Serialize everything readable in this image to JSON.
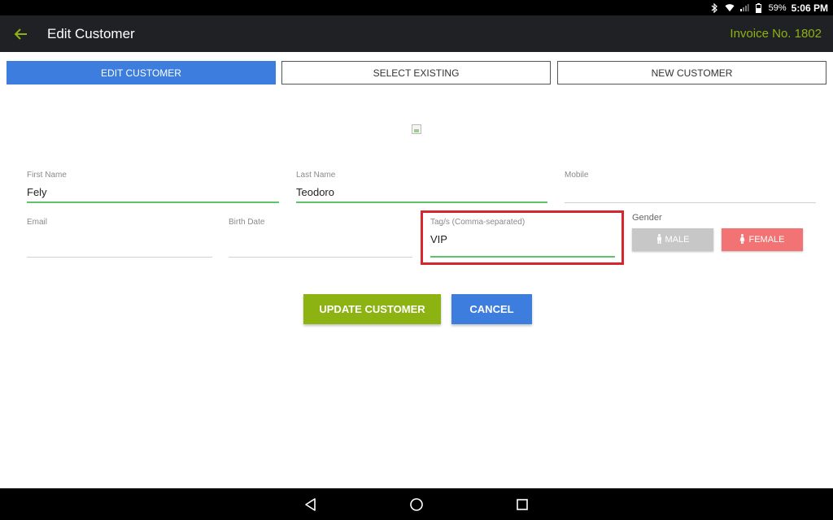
{
  "status_bar": {
    "battery": "59%",
    "time": "5:06 PM",
    "icons": [
      "bluetooth-icon",
      "wifi-icon",
      "signal-icon",
      "battery-icon"
    ]
  },
  "app_bar": {
    "title": "Edit Customer",
    "invoice": "Invoice No. 1802",
    "back_icon": "arrow-left-icon"
  },
  "tabs": [
    {
      "label": "EDIT CUSTOMER",
      "active": true
    },
    {
      "label": "SELECT EXISTING",
      "active": false
    },
    {
      "label": "NEW CUSTOMER",
      "active": false
    }
  ],
  "form": {
    "first_name": {
      "label": "First Name",
      "value": "Fely"
    },
    "last_name": {
      "label": "Last Name",
      "value": "Teodoro"
    },
    "mobile": {
      "label": "Mobile",
      "value": ""
    },
    "email": {
      "label": "Email",
      "value": ""
    },
    "birth_date": {
      "label": "Birth Date",
      "value": ""
    },
    "tags": {
      "label": "Tag/s (Comma-separated)",
      "value": "VIP"
    },
    "gender": {
      "label": "Gender",
      "male": "MALE",
      "female": "FEMALE"
    }
  },
  "actions": {
    "update": "UPDATE CUSTOMER",
    "cancel": "CANCEL"
  },
  "colors": {
    "accent_blue": "#3c7ddd",
    "accent_green": "#8db312",
    "female_pink": "#f27373",
    "highlight_red": "#d8262e"
  },
  "nav_bar": {
    "icons": [
      "back-triangle-icon",
      "home-circle-icon",
      "recents-square-icon"
    ]
  }
}
